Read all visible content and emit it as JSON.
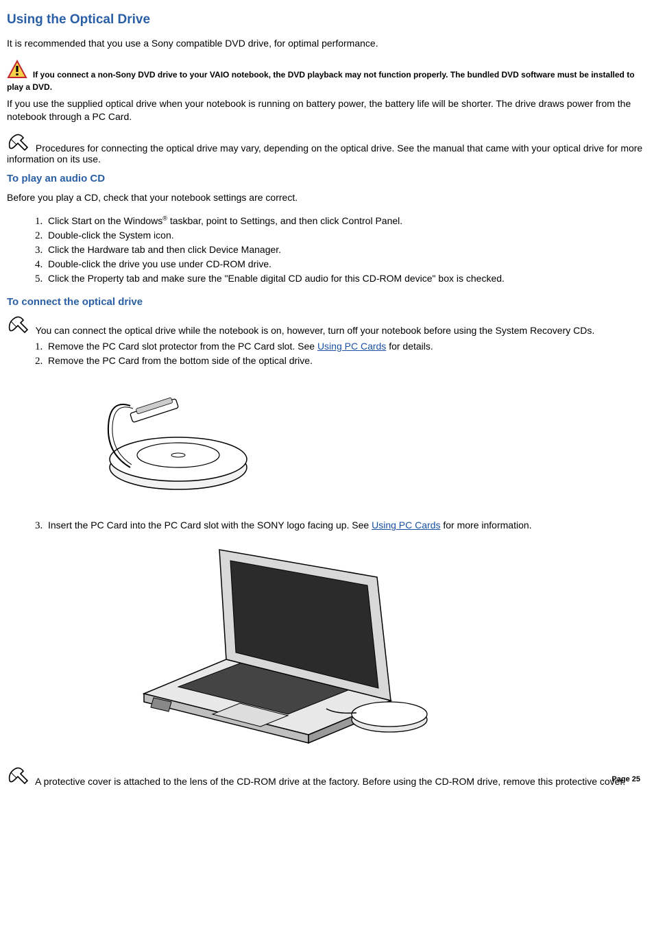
{
  "title": "Using the Optical Drive",
  "intro": "It is recommended that you use a Sony compatible DVD drive, for optimal performance.",
  "warning": "If you connect a non-Sony DVD drive to your VAIO notebook, the DVD playback may not function properly. The bundled DVD software must be installed to play a DVD.",
  "battery_para": "If you use the supplied optical drive when your notebook is running on battery power, the battery life will be shorter. The drive draws power from the notebook through a PC Card.",
  "note1": "Procedures for connecting the optical drive may vary, depending on the optical drive. See the manual that came with your optical drive for more information on its use.",
  "h2a": "To play an audio CD",
  "pre_list_a": "Before you play a CD, check that your notebook settings are correct.",
  "list_a": {
    "i1a": "Click Start on the Windows",
    "i1b": " taskbar, point to Settings, and then click Control Panel.",
    "reg": "®",
    "i2": "Double-click the System icon.",
    "i3": "Click the Hardware tab and then click Device Manager.",
    "i4": "Double-click the drive you use under CD-ROM drive.",
    "i5": "Click the Property tab and make sure the \"Enable digital CD audio for this CD-ROM device\" box is checked."
  },
  "h2b": "To connect the optical drive",
  "note2": "You can connect the optical drive while the notebook is on, however, turn off your notebook before using the System Recovery CDs.",
  "list_b": {
    "i1a": "Remove the PC Card slot protector from the PC Card slot. See ",
    "link1": "Using PC Cards",
    "i1b": " for details.",
    "i2": "Remove the PC Card from the bottom side of the optical drive.",
    "i3a": "Insert the PC Card into the PC Card slot with the SONY logo facing up. See ",
    "link2": "Using PC Cards",
    "i3b": " for more information."
  },
  "note3": "A protective cover is attached to the lens of the CD-ROM drive at the factory. Before using the CD-ROM drive, remove this protective cover.",
  "page_label": "Page 25"
}
